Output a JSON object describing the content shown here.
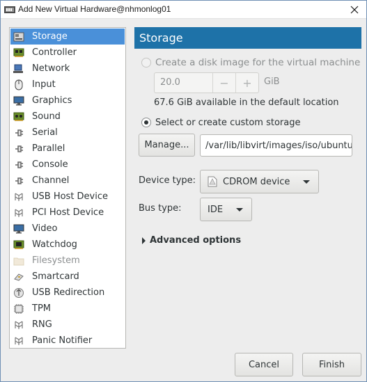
{
  "window": {
    "title": "Add New Virtual Hardware@nhmonlog01",
    "app_icon": "virt-manager-icon",
    "close_icon": "close-icon"
  },
  "sidebar": {
    "items": [
      {
        "label": "Storage",
        "icon": "disk-icon",
        "selected": true,
        "disabled": false
      },
      {
        "label": "Controller",
        "icon": "controller-icon",
        "selected": false,
        "disabled": false
      },
      {
        "label": "Network",
        "icon": "network-icon",
        "selected": false,
        "disabled": false
      },
      {
        "label": "Input",
        "icon": "mouse-icon",
        "selected": false,
        "disabled": false
      },
      {
        "label": "Graphics",
        "icon": "monitor-icon",
        "selected": false,
        "disabled": false
      },
      {
        "label": "Sound",
        "icon": "sound-card-icon",
        "selected": false,
        "disabled": false
      },
      {
        "label": "Serial",
        "icon": "plug-icon",
        "selected": false,
        "disabled": false
      },
      {
        "label": "Parallel",
        "icon": "plug-icon",
        "selected": false,
        "disabled": false
      },
      {
        "label": "Console",
        "icon": "plug-icon",
        "selected": false,
        "disabled": false
      },
      {
        "label": "Channel",
        "icon": "plug-icon",
        "selected": false,
        "disabled": false
      },
      {
        "label": "USB Host Device",
        "icon": "device-icon",
        "selected": false,
        "disabled": false
      },
      {
        "label": "PCI Host Device",
        "icon": "device-icon",
        "selected": false,
        "disabled": false
      },
      {
        "label": "Video",
        "icon": "monitor-icon",
        "selected": false,
        "disabled": false
      },
      {
        "label": "Watchdog",
        "icon": "watchdog-icon",
        "selected": false,
        "disabled": false
      },
      {
        "label": "Filesystem",
        "icon": "folder-icon",
        "selected": false,
        "disabled": true
      },
      {
        "label": "Smartcard",
        "icon": "smartcard-icon",
        "selected": false,
        "disabled": false
      },
      {
        "label": "USB Redirection",
        "icon": "usb-redirect-icon",
        "selected": false,
        "disabled": false
      },
      {
        "label": "TPM",
        "icon": "chip-icon",
        "selected": false,
        "disabled": false
      },
      {
        "label": "RNG",
        "icon": "device-icon",
        "selected": false,
        "disabled": false
      },
      {
        "label": "Panic Notifier",
        "icon": "device-icon",
        "selected": false,
        "disabled": false
      }
    ]
  },
  "main": {
    "header": "Storage",
    "create_disk": {
      "label": "Create a disk image for the virtual machine",
      "checked": false,
      "disabled": true,
      "size_value": "20.0",
      "size_unit": "GiB",
      "minus": "−",
      "plus": "+",
      "available_text": "67.6 GiB available in the default location"
    },
    "custom_storage": {
      "label": "Select or create custom storage",
      "checked": true,
      "manage_button": "Manage...",
      "path_value": "/var/lib/libvirt/images/iso/ubuntu"
    },
    "device_type": {
      "label": "Device type:",
      "value": "CDROM device",
      "icon": "cdrom-icon"
    },
    "bus_type": {
      "label": "Bus type:",
      "value": "IDE"
    },
    "advanced_options": {
      "label": "Advanced options",
      "expanded": false
    }
  },
  "footer": {
    "cancel": "Cancel",
    "finish": "Finish"
  }
}
